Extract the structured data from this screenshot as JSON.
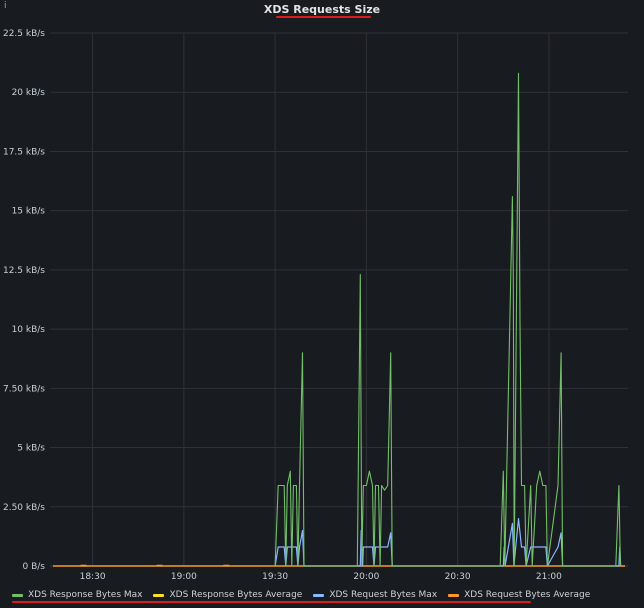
{
  "panel": {
    "title": "XDS Requests Size",
    "info_icon": "info-icon"
  },
  "chart_data": {
    "type": "line",
    "title": "XDS Requests Size",
    "xlabel": "",
    "ylabel": "",
    "y_unit": "kB/s",
    "ylim": [
      0,
      22.5
    ],
    "y_ticks": [
      "0 B/s",
      "2.50 kB/s",
      "5 kB/s",
      "7.50 kB/s",
      "10 kB/s",
      "12.5 kB/s",
      "15 kB/s",
      "17.5 kB/s",
      "20 kB/s",
      "22.5 kB/s"
    ],
    "xlim": [
      "18:16",
      "21:26"
    ],
    "x_ticks": [
      "18:30",
      "19:00",
      "19:30",
      "20:00",
      "20:30",
      "21:00"
    ],
    "grid": true,
    "legend_position": "bottom",
    "series": [
      {
        "name": "XDS Response Bytes Max",
        "color": "#73bf69",
        "points": [
          [
            "19:30",
            0
          ],
          [
            "19:31",
            3.4
          ],
          [
            "19:32",
            3.4
          ],
          [
            "19:33",
            3.4
          ],
          [
            "19:33.5",
            0
          ],
          [
            "19:34",
            3.4
          ],
          [
            "19:35",
            4.0
          ],
          [
            "19:35.5",
            0
          ],
          [
            "19:36",
            3.4
          ],
          [
            "19:37",
            3.4
          ],
          [
            "19:37.5",
            0
          ],
          [
            "19:38",
            3.4
          ],
          [
            "19:39",
            9.0
          ],
          [
            "19:39.5",
            0
          ],
          [
            "19:57",
            0
          ],
          [
            "19:58",
            12.3
          ],
          [
            "19:58.5",
            0
          ],
          [
            "19:59",
            3.4
          ],
          [
            "20:00",
            3.4
          ],
          [
            "20:01",
            4.0
          ],
          [
            "20:02",
            3.4
          ],
          [
            "20:02.5",
            0
          ],
          [
            "20:03",
            3.4
          ],
          [
            "20:04",
            3.4
          ],
          [
            "20:04.5",
            0
          ],
          [
            "20:05",
            3.4
          ],
          [
            "20:06",
            3.2
          ],
          [
            "20:07",
            3.4
          ],
          [
            "20:08",
            9.0
          ],
          [
            "20:08.5",
            0
          ],
          [
            "20:44",
            0
          ],
          [
            "20:45",
            4.0
          ],
          [
            "20:45.5",
            0
          ],
          [
            "20:48",
            15.6
          ],
          [
            "20:48.3",
            12.2
          ],
          [
            "20:48.6",
            0
          ],
          [
            "20:50",
            20.8
          ],
          [
            "20:50.5",
            10.3
          ],
          [
            "20:51",
            3.4
          ],
          [
            "20:52",
            3.4
          ],
          [
            "20:52.5",
            0
          ],
          [
            "20:54",
            3.4
          ],
          [
            "20:54.5",
            0
          ],
          [
            "20:56",
            3.4
          ],
          [
            "20:57",
            4.0
          ],
          [
            "20:58",
            3.4
          ],
          [
            "20:59",
            3.4
          ],
          [
            "20:59.5",
            0
          ],
          [
            "21:03",
            3.4
          ],
          [
            "21:04",
            9.0
          ],
          [
            "21:04.5",
            0
          ],
          [
            "21:22",
            0
          ],
          [
            "21:23",
            3.4
          ],
          [
            "21:23.5",
            0
          ]
        ]
      },
      {
        "name": "XDS Response Bytes Average",
        "color": "#fade2a",
        "points": [
          [
            "18:17",
            0
          ],
          [
            "21:25",
            0
          ]
        ]
      },
      {
        "name": "XDS Request Bytes Max",
        "color": "#8ab8ff",
        "points": [
          [
            "19:30",
            0
          ],
          [
            "19:31",
            0.8
          ],
          [
            "19:33",
            0.8
          ],
          [
            "19:33.5",
            0
          ],
          [
            "19:34",
            0.8
          ],
          [
            "19:37",
            0.8
          ],
          [
            "19:37.5",
            0
          ],
          [
            "19:38",
            0.8
          ],
          [
            "19:39",
            1.5
          ],
          [
            "19:39.5",
            0
          ],
          [
            "19:58",
            0
          ],
          [
            "19:58.3",
            1.5
          ],
          [
            "19:58.8",
            0
          ],
          [
            "19:59",
            0.8
          ],
          [
            "20:02",
            0.8
          ],
          [
            "20:02.5",
            0
          ],
          [
            "20:03",
            0.8
          ],
          [
            "20:07",
            0.8
          ],
          [
            "20:08",
            1.4
          ],
          [
            "20:08.5",
            0
          ],
          [
            "20:45",
            0
          ],
          [
            "20:45.3",
            0.8
          ],
          [
            "20:45.6",
            0
          ],
          [
            "20:48",
            1.8
          ],
          [
            "20:48.5",
            0
          ],
          [
            "20:50",
            2.0
          ],
          [
            "20:51",
            0.8
          ],
          [
            "20:52",
            0.8
          ],
          [
            "20:52.5",
            0
          ],
          [
            "20:54",
            0.8
          ],
          [
            "20:56",
            0.8
          ],
          [
            "20:59",
            0.8
          ],
          [
            "20:59.5",
            0
          ],
          [
            "21:03",
            0.8
          ],
          [
            "21:04",
            1.4
          ],
          [
            "21:04.5",
            0
          ],
          [
            "21:23",
            0
          ],
          [
            "21:23.3",
            0.8
          ],
          [
            "21:23.6",
            0
          ]
        ]
      },
      {
        "name": "XDS Request Bytes Average",
        "color": "#ff9830",
        "points": [
          [
            "18:17",
            0
          ],
          [
            "21:25",
            0
          ]
        ]
      }
    ]
  }
}
